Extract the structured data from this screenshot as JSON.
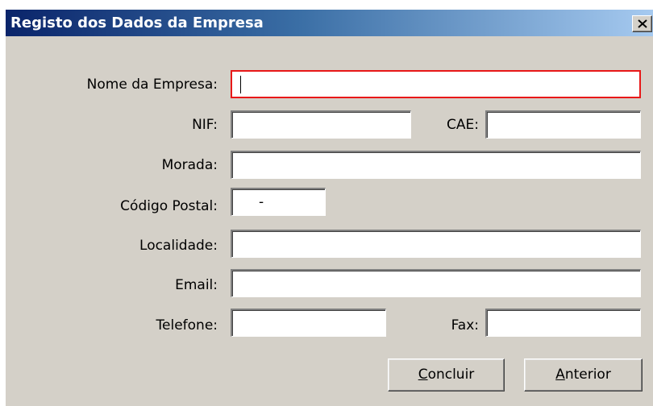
{
  "window": {
    "title": "Registo dos Dados da Empresa"
  },
  "form": {
    "nome_label": "Nome da Empresa:",
    "nome_value": "",
    "nif_label": "NIF:",
    "nif_value": "",
    "cae_label": "CAE:",
    "cae_value": "",
    "morada_label": "Morada:",
    "morada_value": "",
    "codigo_postal_label": "Código Postal:",
    "codigo_postal_value": "-",
    "localidade_label": "Localidade:",
    "localidade_value": "",
    "email_label": "Email:",
    "email_value": "",
    "telefone_label": "Telefone:",
    "telefone_value": "",
    "fax_label": "Fax:",
    "fax_value": ""
  },
  "buttons": {
    "concluir_mnemonic": "C",
    "concluir_rest": "oncluir",
    "anterior_mnemonic": "A",
    "anterior_rest": "nterior"
  },
  "colors": {
    "titlebar_start": "#0a246a",
    "titlebar_end": "#a6caf0",
    "dialog_bg": "#d4d0c8",
    "focus_border": "#e81818"
  }
}
